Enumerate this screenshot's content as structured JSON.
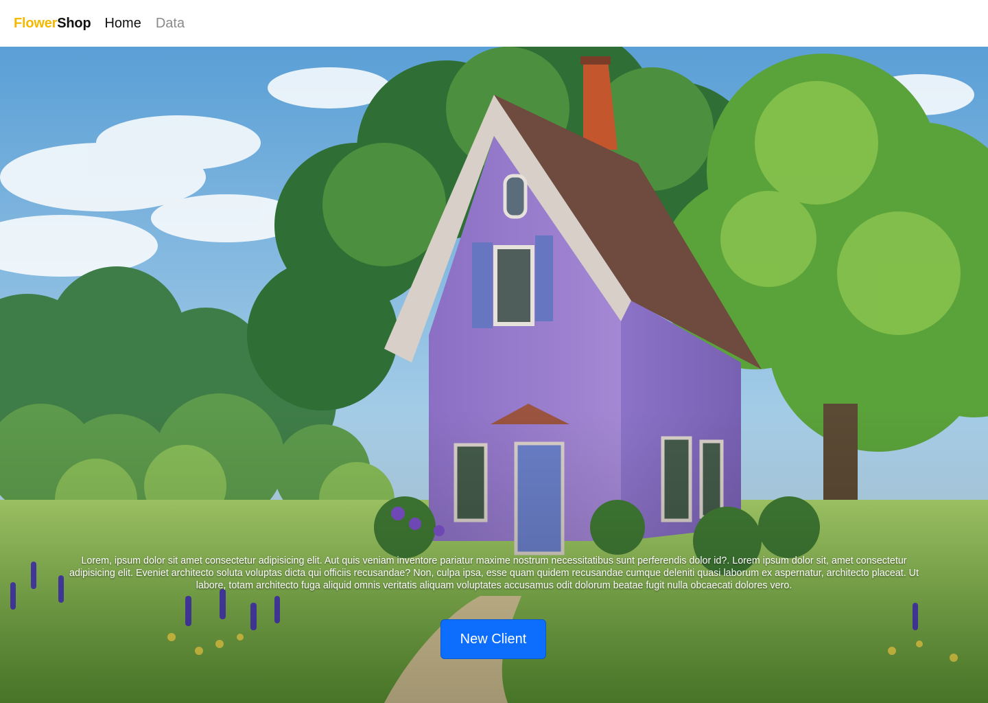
{
  "navbar": {
    "brand_part1": "Flower",
    "brand_part2": "Shop",
    "links": [
      {
        "label": "Home",
        "state": "active"
      },
      {
        "label": "Data",
        "state": "inactive"
      }
    ]
  },
  "hero": {
    "background_image": "illustrated-purple-cottage-in-meadow",
    "description": "Lorem, ipsum dolor sit amet consectetur adipisicing elit. Aut quis veniam inventore pariatur maxime nostrum necessitatibus sunt perferendis dolor id?. Lorem ipsum dolor sit, amet consectetur adipisicing elit. Eveniet architecto soluta voluptas dicta qui officiis recusandae? Non, culpa ipsa, esse quam quidem recusandae cumque deleniti quasi laborum ex aspernatur, architecto placeat. Ut labore, totam architecto fuga aliquid omnis veritatis aliquam voluptates accusamus odit dolorum beatae fugit nulla obcaecati dolores vero.",
    "cta_label": "New Client"
  },
  "colors": {
    "brand_accent": "#f5b800",
    "brand_dark": "#111111",
    "nav_muted": "#8a8a8a",
    "button_primary": "#0d6efd"
  }
}
